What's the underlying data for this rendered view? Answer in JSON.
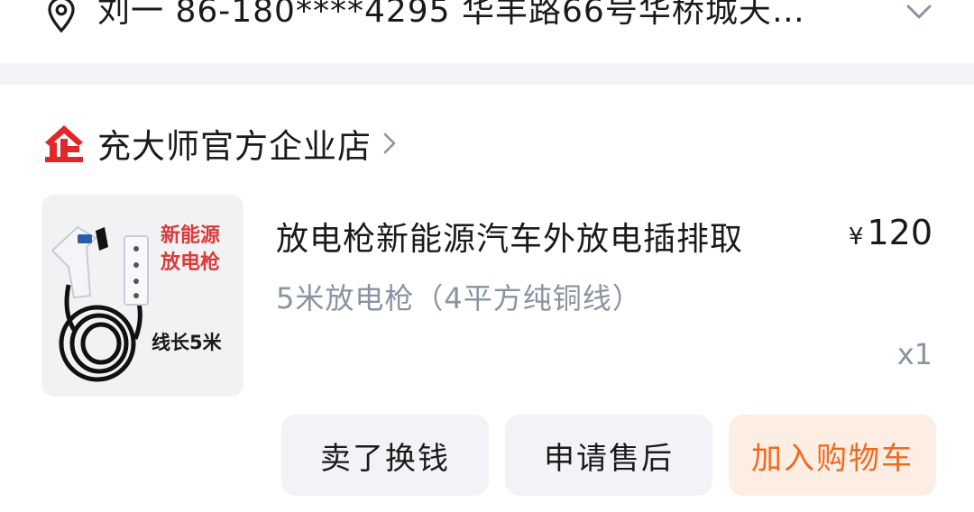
{
  "address": {
    "text": "刘一  86-180****4295  华丰路66号华桥城天…",
    "icon": "location-pin-icon",
    "expand_icon": "chevron-down-icon"
  },
  "shop": {
    "badge_icon": "enterprise-badge-icon",
    "name": "充大师官方企业店",
    "chevron_icon": "chevron-right-icon",
    "badge_color": "#e0272a"
  },
  "product": {
    "image_labels": [
      "新能源",
      "放电枪",
      "线长5米"
    ],
    "title": "放电枪新能源汽车外放电插排取",
    "currency": "¥",
    "price": "120",
    "spec": "5米放电枪（4平方纯铜线）",
    "quantity": "x1"
  },
  "actions": {
    "sell": "卖了换钱",
    "after_sale": "申请售后",
    "add_to_cart": "加入购物车",
    "accent_color": "#f06a1f"
  }
}
